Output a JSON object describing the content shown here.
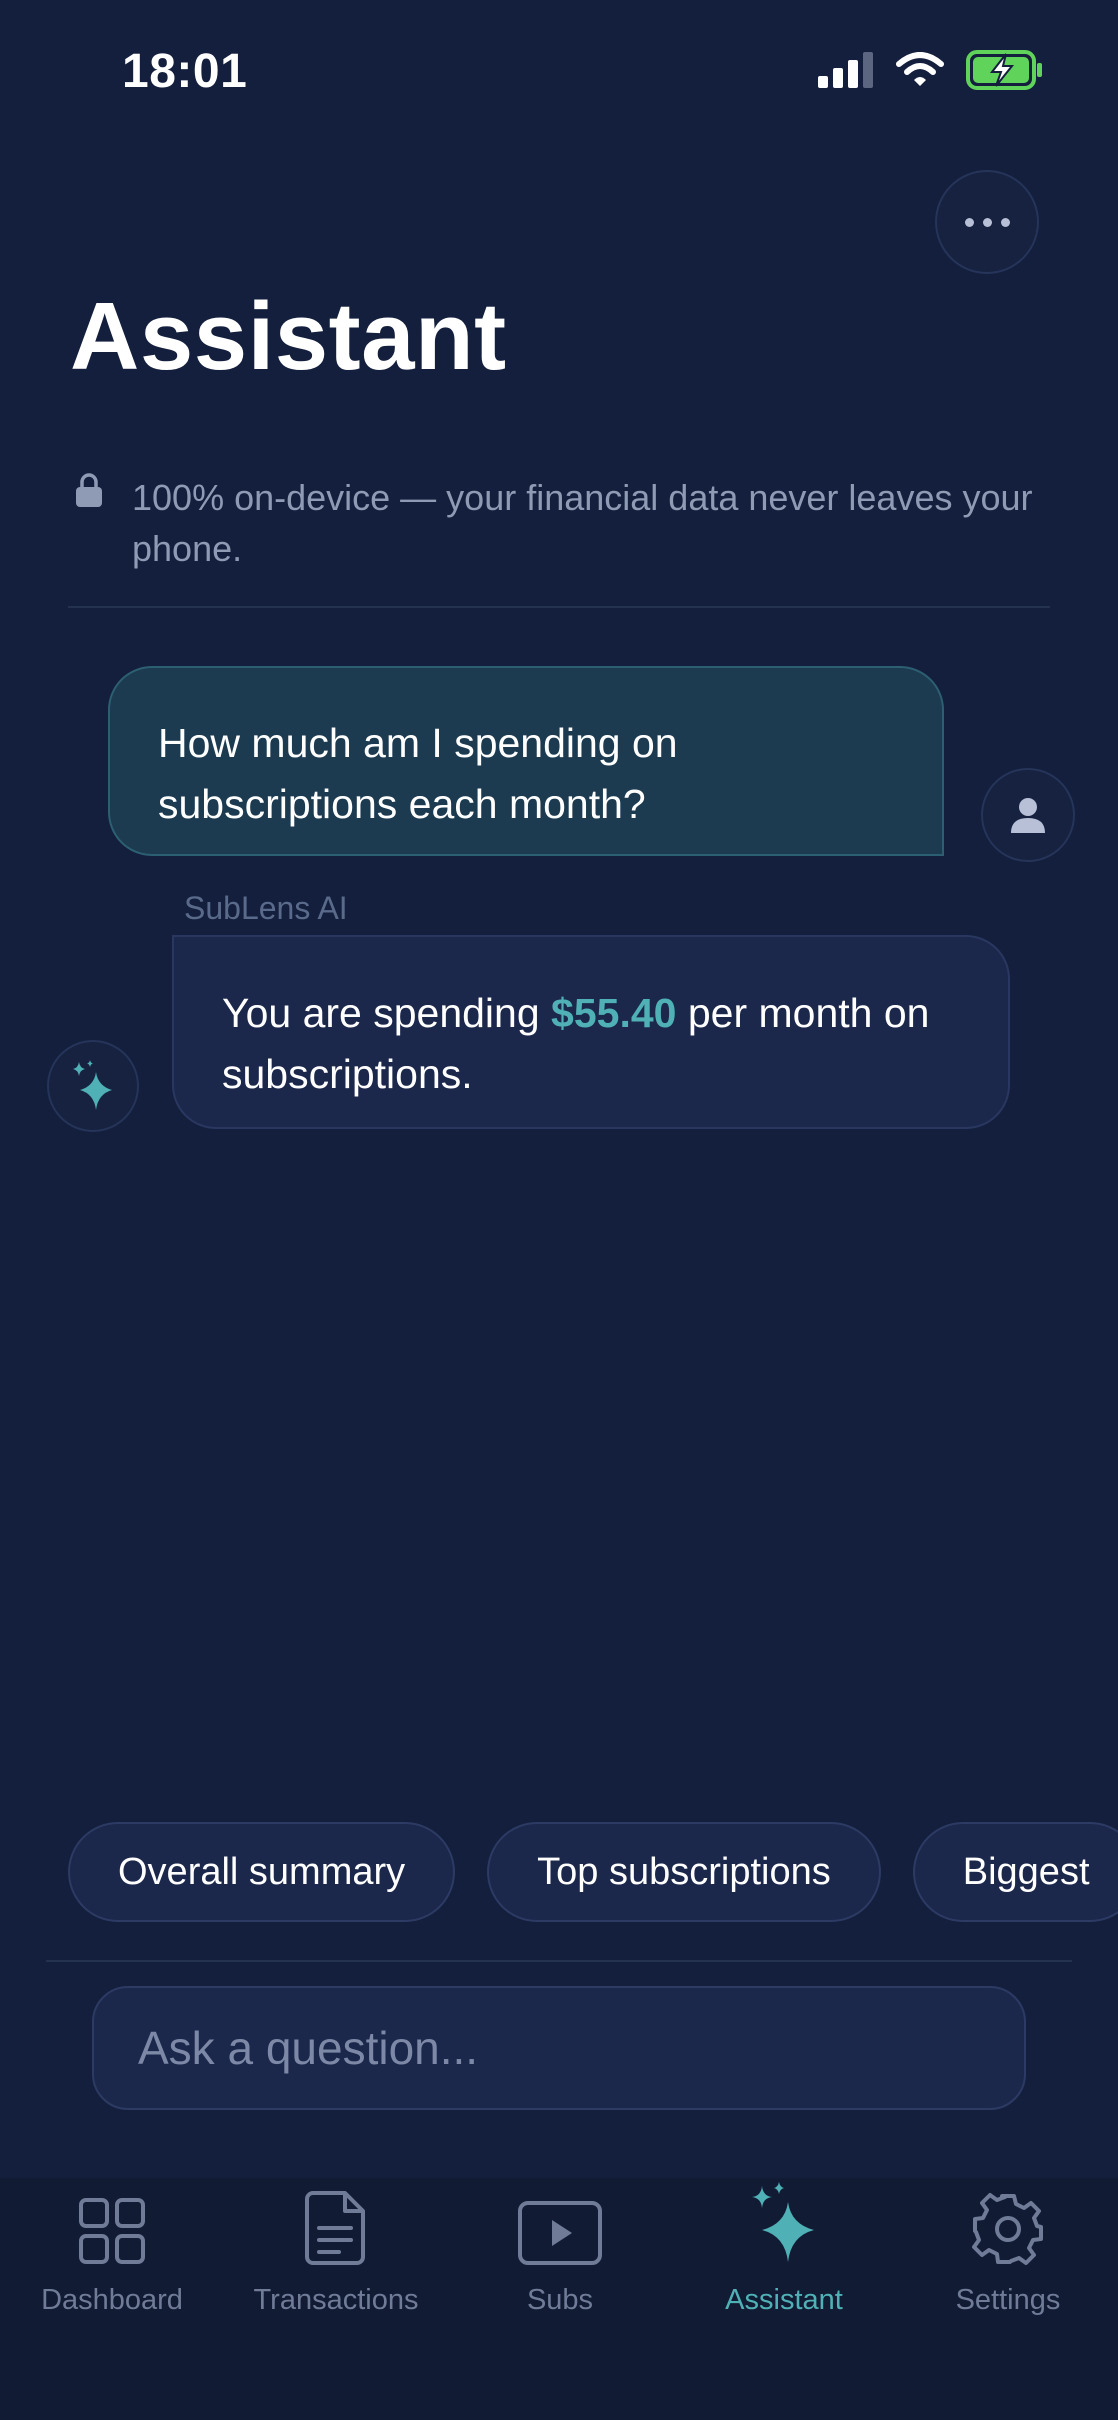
{
  "status_bar": {
    "time": "18:01"
  },
  "header": {
    "title": "Assistant"
  },
  "privacy": {
    "text": "100% on-device — your financial data never leaves your phone."
  },
  "chat": {
    "user_message": "How much am I spending on subscriptions each month?",
    "ai_name": "SubLens AI",
    "ai_message_before": "You are spending ",
    "ai_message_amount": "$55.40",
    "ai_message_after": " per month on subscriptions."
  },
  "suggestions": [
    "Overall summary",
    "Top subscriptions",
    "Biggest"
  ],
  "input": {
    "placeholder": "Ask a question..."
  },
  "tabbar": {
    "items": [
      {
        "label": "Dashboard",
        "icon": "grid-icon"
      },
      {
        "label": "Transactions",
        "icon": "document-icon"
      },
      {
        "label": "Subs",
        "icon": "play-icon"
      },
      {
        "label": "Assistant",
        "icon": "sparkle-icon"
      },
      {
        "label": "Settings",
        "icon": "gear-icon"
      }
    ],
    "active_index": 3
  },
  "colors": {
    "background": "#131f3c",
    "accent": "#4fb0b5",
    "user_bubble": "#1c3a50",
    "ai_bubble": "#1b274b",
    "battery": "#5fd35a"
  }
}
